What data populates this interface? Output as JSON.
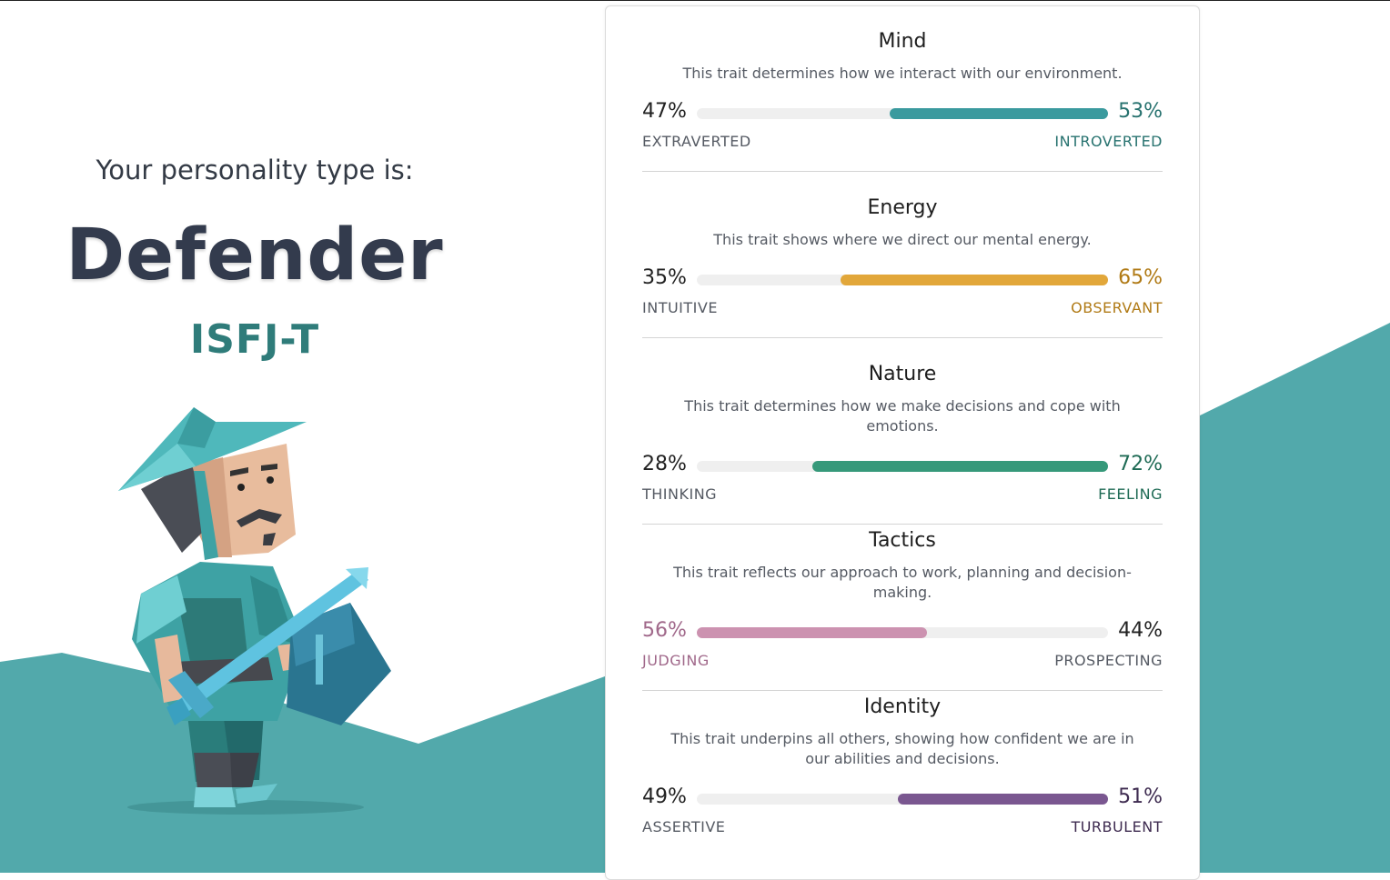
{
  "header": {
    "intro": "Your personality type is:",
    "type_name": "Defender",
    "type_code": "ISFJ-T"
  },
  "colors": {
    "teal_bg": "#52a9ab",
    "mind": "#3a9a9e",
    "energy": "#e2a73a",
    "nature": "#36997a",
    "tactics": "#cc92b0",
    "identity": "#7a5790",
    "neutral_text": "#222222",
    "label_neutral": "#555a63"
  },
  "traits": [
    {
      "title": "Mind",
      "description": "This trait determines how we interact with our environment.",
      "left_percent": "47%",
      "right_percent": "53%",
      "left_label": "EXTRAVERTED",
      "right_label": "INTROVERTED",
      "dominant": "right",
      "dominant_fraction": 0.53,
      "color": "#3a9a9e",
      "text_color": "#27726f"
    },
    {
      "title": "Energy",
      "description": "This trait shows where we direct our mental energy.",
      "left_percent": "35%",
      "right_percent": "65%",
      "left_label": "INTUITIVE",
      "right_label": "OBSERVANT",
      "dominant": "right",
      "dominant_fraction": 0.65,
      "color": "#e2a73a",
      "text_color": "#b07a15"
    },
    {
      "title": "Nature",
      "description": "This trait determines how we make decisions and cope with emotions.",
      "left_percent": "28%",
      "right_percent": "72%",
      "left_label": "THINKING",
      "right_label": "FEELING",
      "dominant": "right",
      "dominant_fraction": 0.72,
      "color": "#36997a",
      "text_color": "#1f6b55"
    },
    {
      "title": "Tactics",
      "description": "This trait reflects our approach to work, planning and decision-making.",
      "left_percent": "56%",
      "right_percent": "44%",
      "left_label": "JUDGING",
      "right_label": "PROSPECTING",
      "dominant": "left",
      "dominant_fraction": 0.56,
      "color": "#cc92b0",
      "text_color": "#a0688a"
    },
    {
      "title": "Identity",
      "description": "This trait underpins all others, showing how confident we are in our abilities and decisions.",
      "left_percent": "49%",
      "right_percent": "51%",
      "left_label": "ASSERTIVE",
      "right_label": "TURBULENT",
      "dominant": "right",
      "dominant_fraction": 0.51,
      "color": "#7a5790",
      "text_color": "#3e2b50"
    }
  ]
}
